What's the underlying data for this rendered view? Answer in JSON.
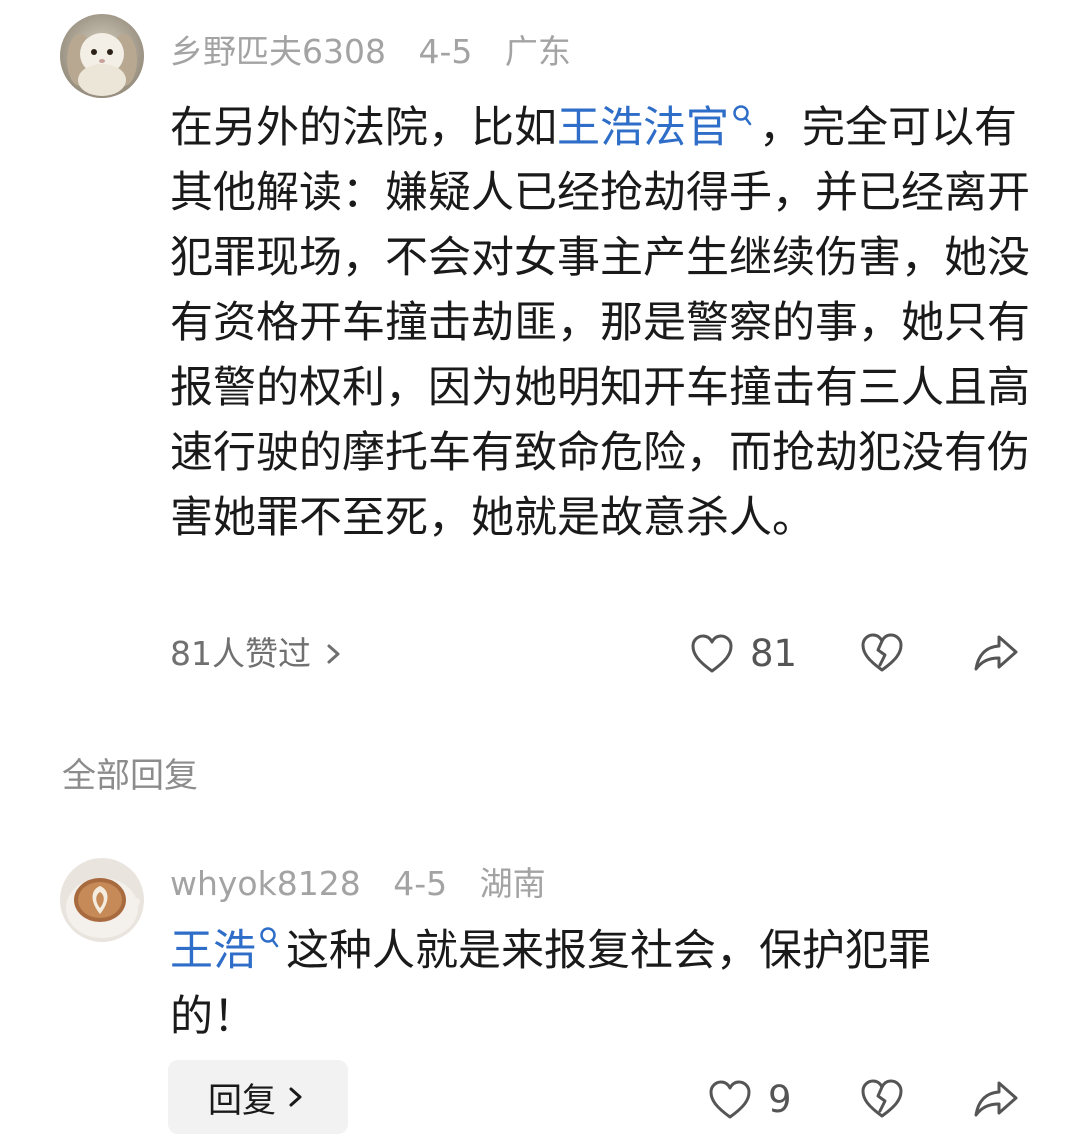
{
  "comment": {
    "username": "乡野匹夫6308",
    "date": "4-5",
    "location": "广东",
    "text_before": "在另外的法院，比如",
    "link_text": "王浩法官",
    "text_after": "，完全可以有其他解读：嫌疑人已经抢劫得手，并已经离开犯罪现场，不会对女事主产生继续伤害，她没有资格开车撞击劫匪，那是警察的事，她只有报警的权利，因为她明知开车撞击有三人且高速行驶的摩托车有致命危险，而抢劫犯没有伤害她罪不至死，她就是故意杀人。",
    "likes_summary": "81人赞过",
    "like_count": "81"
  },
  "replies_section": {
    "title": "全部回复"
  },
  "reply": {
    "username": "whyok8128",
    "date": "4-5",
    "location": "湖南",
    "link_text": "王浩",
    "text_after": "这种人就是来报复社会，保护犯罪的！",
    "reply_button_label": "回复",
    "like_count": "9"
  },
  "colors": {
    "link": "#2f6ec8",
    "meta_gray": "#a3a3a3",
    "icon_gray": "#555555"
  },
  "icons": [
    "heart-icon",
    "broken-heart-icon",
    "share-icon",
    "chevron-right-icon",
    "search-icon"
  ]
}
